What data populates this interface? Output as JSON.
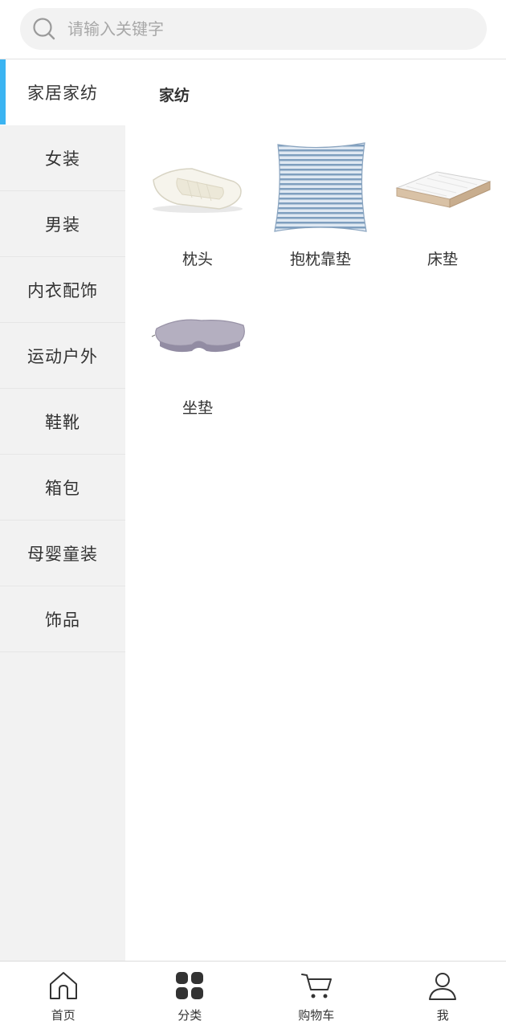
{
  "search": {
    "placeholder": "请输入关键字"
  },
  "sidebar": {
    "items": [
      {
        "label": "家居家纺",
        "active": true
      },
      {
        "label": "女装"
      },
      {
        "label": "男装"
      },
      {
        "label": "内衣配饰"
      },
      {
        "label": "运动户外"
      },
      {
        "label": "鞋靴"
      },
      {
        "label": "箱包"
      },
      {
        "label": "母婴童装"
      },
      {
        "label": "饰品"
      }
    ]
  },
  "main": {
    "section_title": "家纺",
    "products": [
      {
        "label": "枕头",
        "icon": "pillow-icon"
      },
      {
        "label": "抱枕靠垫",
        "icon": "cushion-icon"
      },
      {
        "label": "床垫",
        "icon": "mattress-icon"
      },
      {
        "label": "坐垫",
        "icon": "seat-cushion-icon"
      }
    ]
  },
  "tabbar": {
    "items": [
      {
        "label": "首页",
        "icon": "home-icon"
      },
      {
        "label": "分类",
        "icon": "category-icon",
        "active": true
      },
      {
        "label": "购物车",
        "icon": "cart-icon"
      },
      {
        "label": "我",
        "icon": "user-icon"
      }
    ]
  },
  "colors": {
    "accent": "#3bb4f2",
    "sidebar_bg": "#f2f2f2"
  }
}
